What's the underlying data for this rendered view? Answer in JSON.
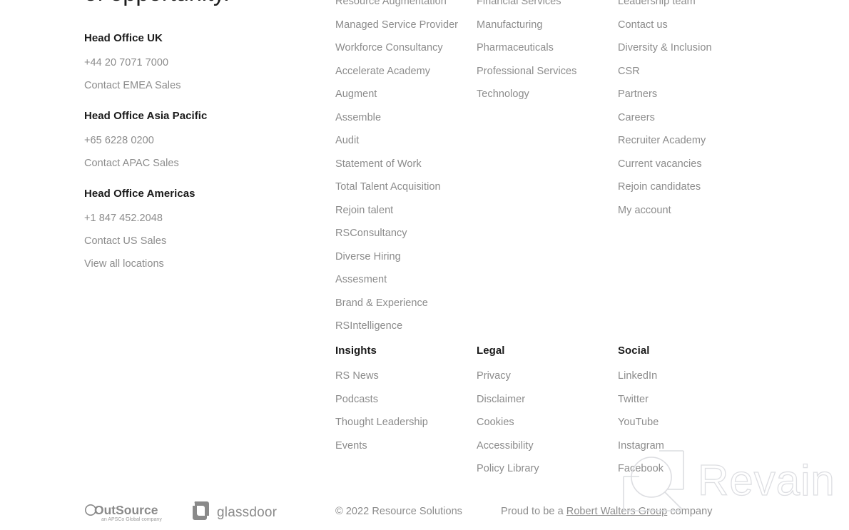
{
  "headline_fragment": "of opportunity.",
  "contact": {
    "offices": [
      {
        "title": "Head Office UK",
        "phone": "+44 20 7071 7000",
        "sales_link": "Contact EMEA Sales"
      },
      {
        "title": "Head Office Asia Pacific",
        "phone": "+65 6228 0200",
        "sales_link": "Contact APAC Sales"
      },
      {
        "title": "Head Office Americas",
        "phone": "+1 847 452.2048",
        "sales_link": "Contact US Sales",
        "extra_link": "View all locations"
      }
    ]
  },
  "columns": {
    "services": {
      "links": [
        "Resource Augmentation",
        "Managed Service Provider",
        "Workforce Consultancy",
        "Accelerate Academy",
        "Augment",
        "Assemble",
        "Audit",
        "Statement of Work",
        "Total Talent Acquisition",
        "Rejoin talent",
        "RSConsultancy",
        "Diverse Hiring",
        "Assesment",
        "Brand & Experience",
        "RSIntelligence"
      ]
    },
    "industries": {
      "links": [
        "Financial Services",
        "Manufacturing",
        "Pharmaceuticals",
        "Professional Services",
        "Technology"
      ]
    },
    "company": {
      "links": [
        "Leadership team",
        "Contact us",
        "Diversity & Inclusion",
        "CSR",
        "Partners",
        "Careers",
        "Recruiter Academy",
        "Current vacancies",
        "Rejoin candidates",
        "My account"
      ]
    },
    "insights": {
      "heading": "Insights",
      "links": [
        "RS News",
        "Podcasts",
        "Thought Leadership",
        "Events"
      ]
    },
    "legal": {
      "heading": "Legal",
      "links": [
        "Privacy",
        "Disclaimer",
        "Cookies",
        "Accessibility",
        "Policy Library"
      ]
    },
    "social": {
      "heading": "Social",
      "links": [
        "LinkedIn",
        "Twitter",
        "YouTube",
        "Instagram",
        "Facebook"
      ]
    }
  },
  "bottom": {
    "outsource_logo_name": "OutSource",
    "outsource_logo_tagline": "an APSCo Global company",
    "glassdoor_logo_name": "glassdoor",
    "copyright": "© 2022 Resource Solutions",
    "proud_prefix": "Proud to be a ",
    "proud_link": "Robert Walters Group",
    "proud_suffix": " company"
  },
  "watermark": {
    "brand": "Revain"
  },
  "colors": {
    "heading": "#1b1b1b",
    "link": "#8c8c8c",
    "logo_gray": "#8a8a8a",
    "watermark": "#dddee2",
    "background": "#ffffff"
  }
}
